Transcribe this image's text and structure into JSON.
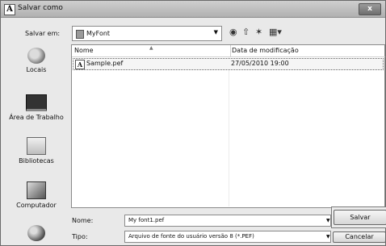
{
  "window": {
    "title": "Salvar como",
    "close_label": "x"
  },
  "toolbar": {
    "save_in_label": "Salvar em:",
    "save_in_value": "MyFont",
    "icons": [
      "back-icon",
      "up-folder-icon",
      "new-folder-icon",
      "views-menu-icon"
    ]
  },
  "places": [
    {
      "label": "Locais",
      "icon": "recent-places-icon"
    },
    {
      "label": "Área de Trabalho",
      "icon": "desktop-icon"
    },
    {
      "label": "Bibliotecas",
      "icon": "libraries-icon"
    },
    {
      "label": "Computador",
      "icon": "computer-icon"
    },
    {
      "label": "",
      "icon": "network-icon"
    }
  ],
  "filelist": {
    "columns": [
      "Nome",
      "Data de modificação"
    ],
    "rows": [
      {
        "name": "Sample.pef",
        "modified": "27/05/2010 19:00"
      }
    ]
  },
  "form": {
    "name_label": "Nome:",
    "name_value": "My font1.pef",
    "type_label": "Tipo:",
    "type_value": "Arquivo de fonte do usuário versão 8 (*.PEF)"
  },
  "buttons": {
    "save": "Salvar",
    "cancel": "Cancelar"
  }
}
